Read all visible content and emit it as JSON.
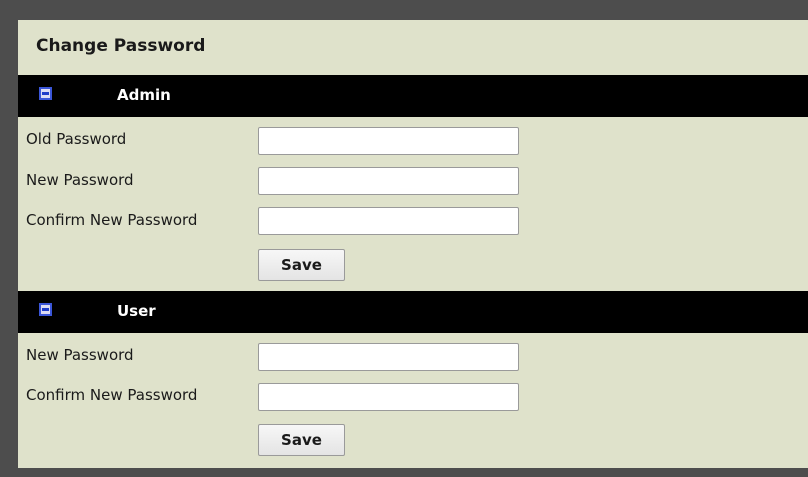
{
  "page_title": "Change Password",
  "admin": {
    "title": "Admin",
    "collapse_icon": "collapse-minus-icon",
    "fields": {
      "old_password": {
        "label": "Old Password",
        "value": ""
      },
      "new_password": {
        "label": "New Password",
        "value": ""
      },
      "confirm_new_password": {
        "label": "Confirm New Password",
        "value": ""
      }
    },
    "save_label": "Save"
  },
  "user": {
    "title": "User",
    "collapse_icon": "collapse-minus-icon",
    "fields": {
      "new_password": {
        "label": "New Password",
        "value": ""
      },
      "confirm_new_password": {
        "label": "Confirm New Password",
        "value": ""
      }
    },
    "save_label": "Save"
  },
  "colors": {
    "page_background": "#4d4d4d",
    "panel_background": "#dfe2cb",
    "section_header_background": "#000000",
    "icon_accent": "#1f3cc9"
  }
}
